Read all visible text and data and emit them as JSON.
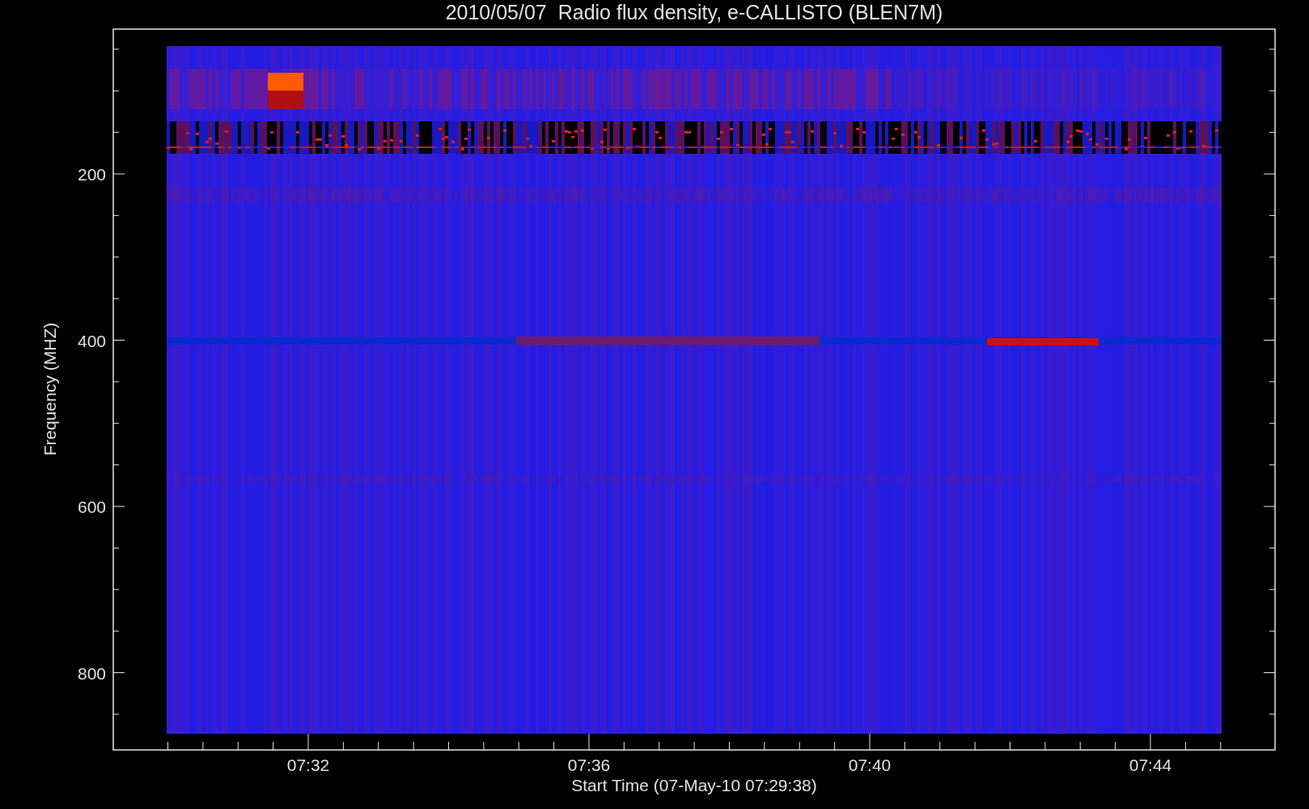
{
  "plot": {
    "title": "2010/05/07  Radio flux density, e-CALLISTO (BLEN7M)",
    "ylabel": "Frequency (MHZ)",
    "xlabel": "Start Time (07-May-10 07:29:38)",
    "y_tick_labels": [
      "200",
      "400",
      "600",
      "800"
    ],
    "x_tick_labels": [
      "07:32",
      "07:36",
      "07:40",
      "07:44"
    ]
  }
}
